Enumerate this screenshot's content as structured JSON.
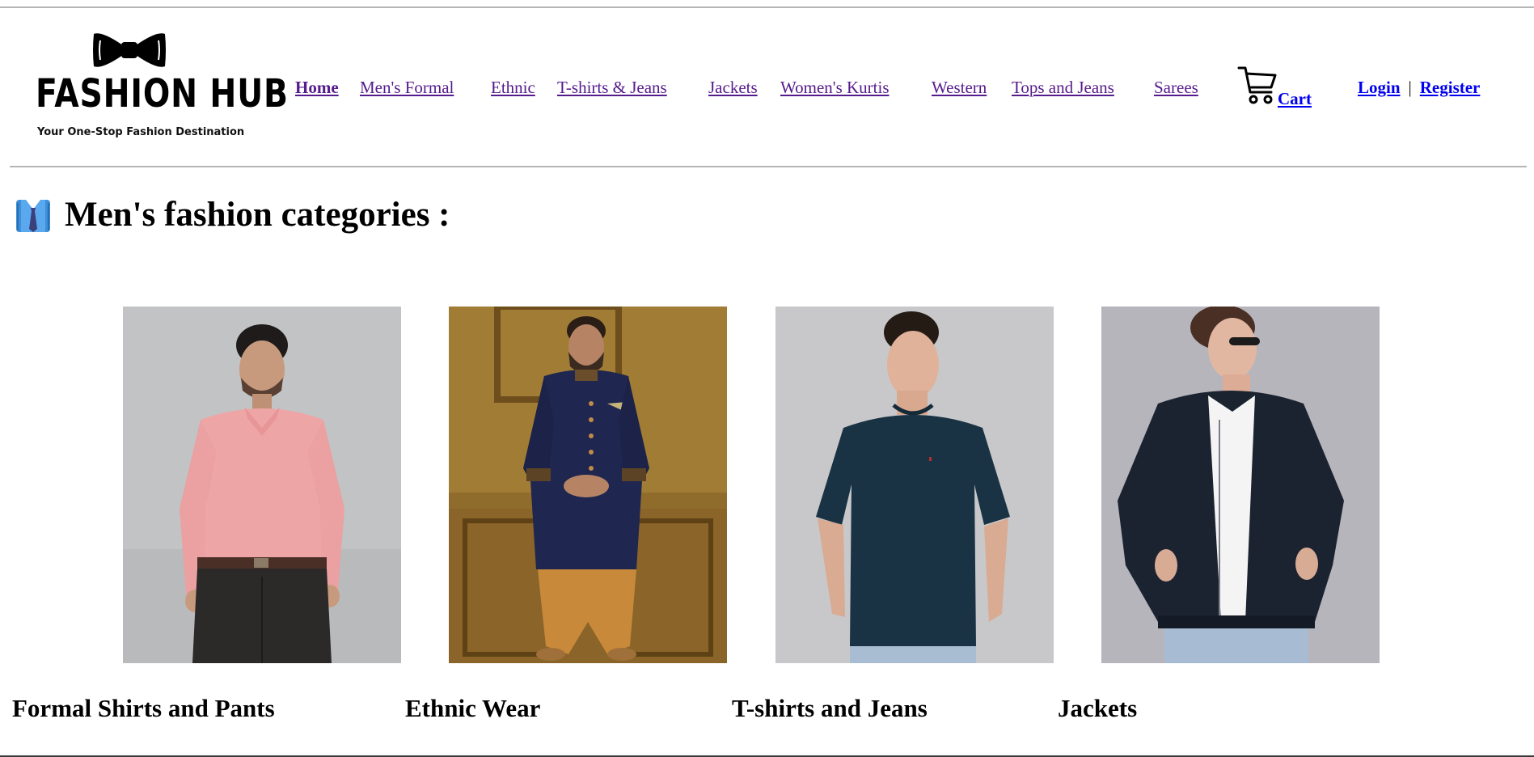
{
  "logo": {
    "brand": "FASHION HUB",
    "tagline": "Your One-Stop Fashion Destination",
    "icon": "bow-tie-icon"
  },
  "nav": {
    "items": [
      {
        "label": "Home",
        "active": true
      },
      {
        "label": "Men's Formal",
        "active": false
      },
      {
        "label": "Ethnic",
        "active": false
      },
      {
        "label": "T-shirts & Jeans",
        "active": false
      },
      {
        "label": "Jackets",
        "active": false
      },
      {
        "label": "Women's Kurtis",
        "active": false
      },
      {
        "label": "Western",
        "active": false
      },
      {
        "label": "Tops and Jeans",
        "active": false
      },
      {
        "label": "Sarees",
        "active": false
      }
    ],
    "cart": {
      "label": "Cart",
      "icon": "cart-icon"
    },
    "login": "Login",
    "separator": "|",
    "register": "Register"
  },
  "section": {
    "title": "Men's fashion categories :",
    "icon": "shirt-tie-icon"
  },
  "categories": [
    {
      "name": "Formal Shirts and Pants",
      "image": "man-in-pink-shirt-photo"
    },
    {
      "name": "Ethnic Wear",
      "image": "man-in-sherwani-photo"
    },
    {
      "name": "T-shirts and Jeans",
      "image": "man-in-navy-tshirt-photo"
    },
    {
      "name": "Jackets",
      "image": "man-in-bomber-jacket-photo"
    }
  ],
  "colors": {
    "visited_link": "#551a8b",
    "link": "#0000ee",
    "rule": "#b5b5b5"
  }
}
